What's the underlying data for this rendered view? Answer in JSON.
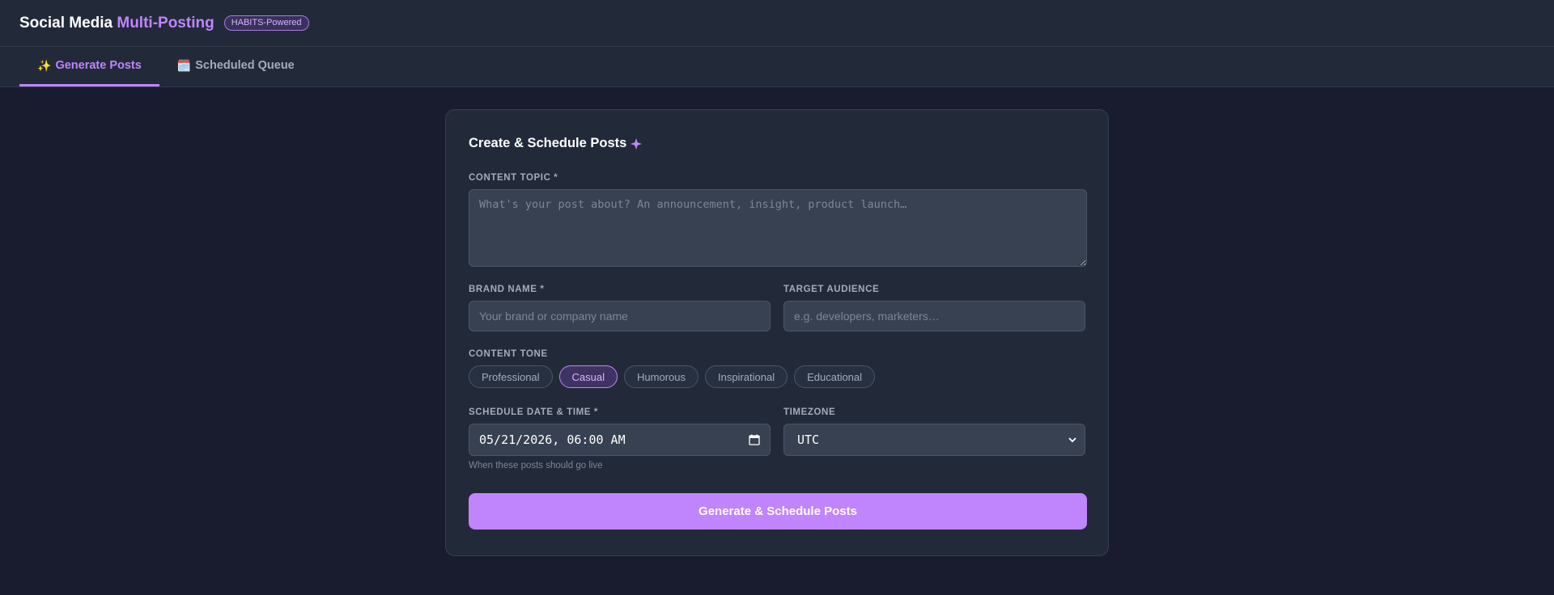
{
  "header": {
    "title_part1": "Social Media ",
    "title_accent": "Multi-Posting",
    "badge": "HABITS-Powered"
  },
  "tabs": [
    {
      "icon": "✨",
      "label": "Generate Posts",
      "active": true
    },
    {
      "icon": "🗓️",
      "label": "Scheduled Queue",
      "active": false
    }
  ],
  "form": {
    "title": "Create & Schedule Posts",
    "topic": {
      "label": "CONTENT TOPIC *",
      "placeholder": "What's your post about? An announcement, insight, product launch…",
      "value": ""
    },
    "brand": {
      "label": "BRAND NAME *",
      "placeholder": "Your brand or company name",
      "value": ""
    },
    "audience": {
      "label": "TARGET AUDIENCE",
      "placeholder": "e.g. developers, marketers…",
      "value": ""
    },
    "tone": {
      "label": "CONTENT TONE",
      "options": [
        "Professional",
        "Casual",
        "Humorous",
        "Inspirational",
        "Educational"
      ],
      "selected": "Casual"
    },
    "schedule": {
      "label": "SCHEDULE DATE & TIME *",
      "value": "05/21/2026, 06:00 AM",
      "hint": "When these posts should go live"
    },
    "timezone": {
      "label": "TIMEZONE",
      "value": "UTC"
    },
    "submit_label": "Generate & Schedule Posts"
  },
  "colors": {
    "accent": "#c084fc",
    "background": "#181c2e",
    "card": "#222a3a",
    "input": "#374151"
  },
  "icons": {
    "title_icon": "sparkle-icon",
    "date_icon": "calendar-icon",
    "select_icon": "chevron-down-icon"
  }
}
